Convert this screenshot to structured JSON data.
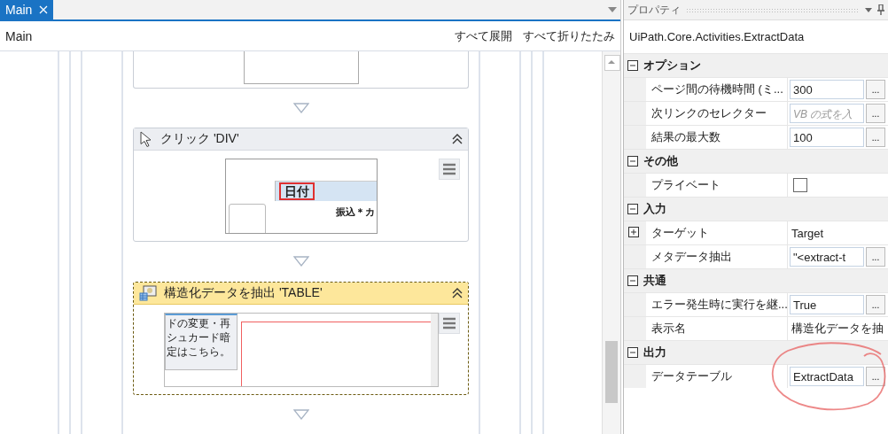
{
  "tabs": [
    {
      "label": "Main",
      "selected": true
    }
  ],
  "breadcrumb": "Main",
  "actions": [
    "すべて展開",
    "すべて折りたたみ"
  ],
  "activities": [
    {
      "kind": "cut"
    },
    {
      "kind": "click",
      "title": "クリック 'DIV'",
      "selected": false,
      "preview": {
        "kind": "header",
        "header": "日付",
        "cell": "振込＊カ"
      }
    },
    {
      "kind": "extract",
      "title": "構造化データを抽出 'TABLE'",
      "selected": true,
      "preview": {
        "kind": "page",
        "lines": [
          "ドの変更・再",
          "シュカード暗",
          "定はこちら。"
        ]
      }
    }
  ],
  "properties": {
    "title": "プロパティ",
    "type_name": "UiPath.Core.Activities.ExtractData",
    "categories": [
      {
        "name": "オプション",
        "expanded": true,
        "rows": [
          {
            "name": "ページ間の待機時間 (ミ...",
            "kind": "input",
            "value": "300",
            "button": "..."
          },
          {
            "name": "次リンクのセレクター",
            "kind": "input",
            "placeholder": "VB の式を入",
            "button": "..."
          },
          {
            "name": "結果の最大数",
            "kind": "input",
            "value": "100",
            "button": "..."
          }
        ]
      },
      {
        "name": "その他",
        "expanded": true,
        "rows": [
          {
            "name": "プライベート",
            "kind": "checkbox",
            "checked": false
          }
        ]
      },
      {
        "name": "入力",
        "expanded": true,
        "rows": [
          {
            "name": "ターゲット",
            "kind": "group",
            "expanded": false,
            "value": "Target"
          },
          {
            "name": "メタデータ抽出",
            "kind": "input",
            "value": "\"<extract-t",
            "button": "..."
          }
        ]
      },
      {
        "name": "共通",
        "expanded": true,
        "rows": [
          {
            "name": "エラー発生時に実行を継...",
            "kind": "input",
            "value": "True",
            "button": "..."
          },
          {
            "name": "表示名",
            "kind": "text",
            "value": "構造化データを抽"
          }
        ]
      },
      {
        "name": "出力",
        "expanded": true,
        "rows": [
          {
            "name": "データテーブル",
            "kind": "input",
            "value": "ExtractData",
            "button": "..."
          }
        ]
      }
    ]
  }
}
